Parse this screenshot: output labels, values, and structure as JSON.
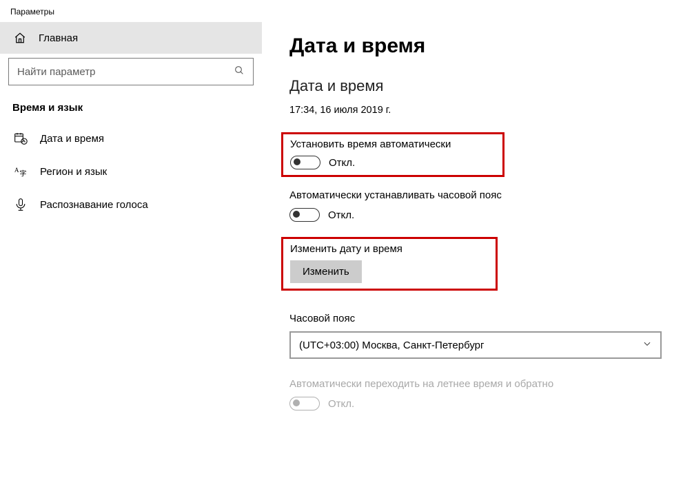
{
  "window": {
    "title": "Параметры"
  },
  "sidebar": {
    "home": "Главная",
    "search_placeholder": "Найти параметр",
    "category": "Время и язык",
    "items": [
      {
        "label": "Дата и время"
      },
      {
        "label": "Регион и язык"
      },
      {
        "label": "Распознавание голоса"
      }
    ]
  },
  "main": {
    "page_title": "Дата и время",
    "section_title": "Дата и время",
    "current_datetime": "17:34, 16 июля 2019 г.",
    "auto_time": {
      "label": "Установить время автоматически",
      "state": "Откл."
    },
    "auto_timezone": {
      "label": "Автоматически устанавливать часовой пояс",
      "state": "Откл."
    },
    "change_datetime": {
      "label": "Изменить дату и время",
      "button": "Изменить"
    },
    "timezone": {
      "label": "Часовой пояс",
      "value": "(UTC+03:00) Москва, Санкт-Петербург"
    },
    "dst": {
      "label": "Автоматически переходить на летнее время и обратно",
      "state": "Откл."
    }
  }
}
